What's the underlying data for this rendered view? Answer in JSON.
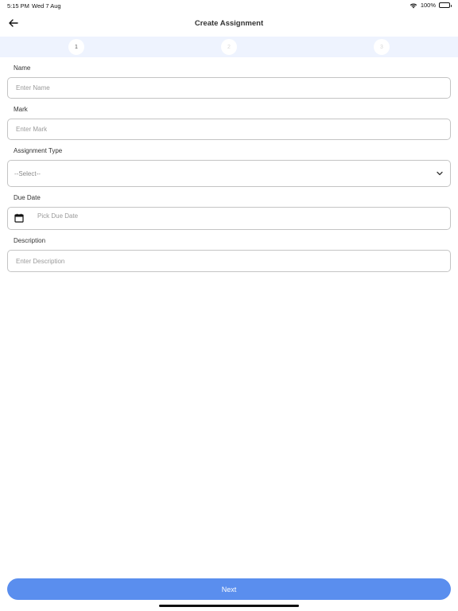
{
  "status_bar": {
    "time": "5:15 PM",
    "date": "Wed 7 Aug",
    "battery": "100%"
  },
  "nav": {
    "title": "Create Assignment",
    "back_icon": "arrow-left-icon"
  },
  "stepper": {
    "steps": [
      "1",
      "2",
      "3"
    ],
    "active_step": 1
  },
  "form": {
    "name": {
      "label": "Name",
      "placeholder": "Enter Name"
    },
    "mark": {
      "label": "Mark",
      "placeholder": "Enter Mark"
    },
    "assignment_type": {
      "label": "Assignment Type",
      "selected": "--Select--"
    },
    "due_date": {
      "label": "Due Date",
      "placeholder": "Pick Due Date",
      "icon": "calendar-icon"
    },
    "description": {
      "label": "Description",
      "placeholder": "Enter Description"
    }
  },
  "actions": {
    "next_label": "Next"
  },
  "colors": {
    "accent": "#5a8eee",
    "stepper_bg": "#eef3fe",
    "border": "#c4c4c4"
  }
}
